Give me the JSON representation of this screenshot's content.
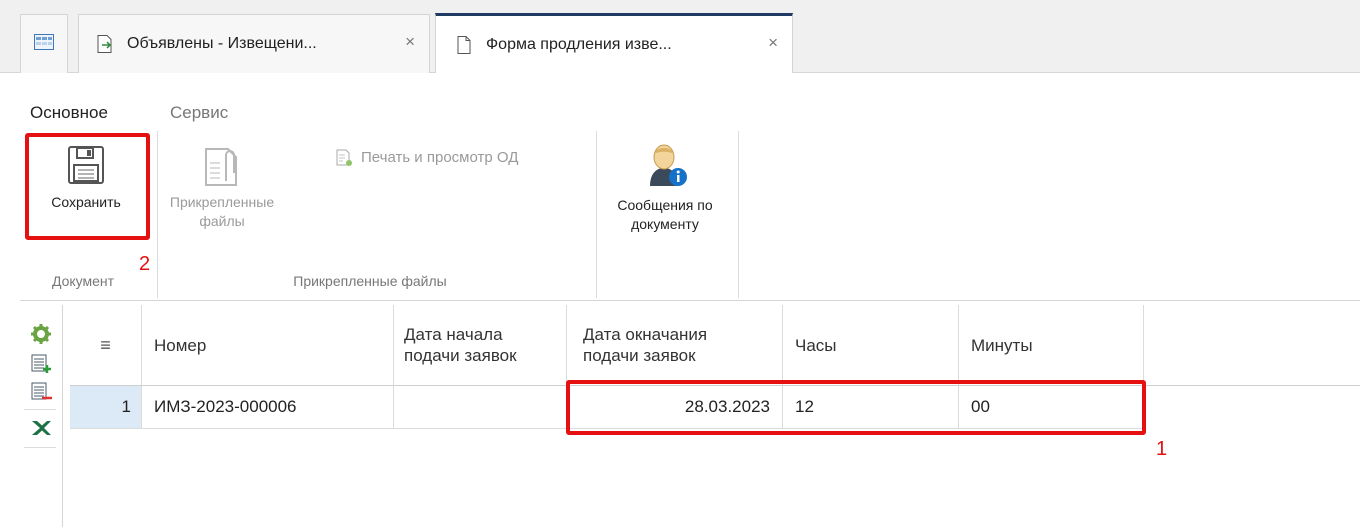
{
  "tabs": {
    "home_icon": "grid-icon",
    "items": [
      {
        "label": "Объявлены - Извещени...",
        "icon": "edit-document-icon",
        "close": "×"
      },
      {
        "label": "Форма продления изве...",
        "icon": "document-icon",
        "close": "×"
      }
    ]
  },
  "menu": {
    "main": "Основное",
    "service": "Сервис"
  },
  "ribbon": {
    "save_label": "Сохранить",
    "document_group": "Документ",
    "attached_files_label_1": "Прикрепленные",
    "attached_files_label_2": "файлы",
    "print_preview_label": "Печать и просмотр ОД",
    "attached_files_group": "Прикрепленные файлы",
    "messages_label_1": "Сообщения по",
    "messages_label_2": "документу"
  },
  "grid": {
    "columns": [
      "≡",
      "Номер",
      "Дата начала подачи заявок",
      "Дата окончания подачи заявок",
      "Часы",
      "Минуты"
    ],
    "column_lines": {
      "start_date_1": "Дата начала",
      "start_date_2": "подачи заявок",
      "end_date_1": "Дата окначания",
      "end_date_2": "подачи заявок"
    },
    "rows": [
      {
        "index": "1",
        "number": "ИМЗ-2023-000006",
        "start_date": "",
        "end_date": "28.03.2023",
        "hours": "12",
        "minutes": "00"
      }
    ]
  },
  "annotations": {
    "save_marker": "2",
    "row_marker": "1",
    "color": "#e51010"
  },
  "colors": {
    "active_tab_accent": "#1f3b63",
    "selected_index_cell": "#dce9f7",
    "toolbar_green": "#6aa341",
    "excel_green": "#1e7145"
  }
}
